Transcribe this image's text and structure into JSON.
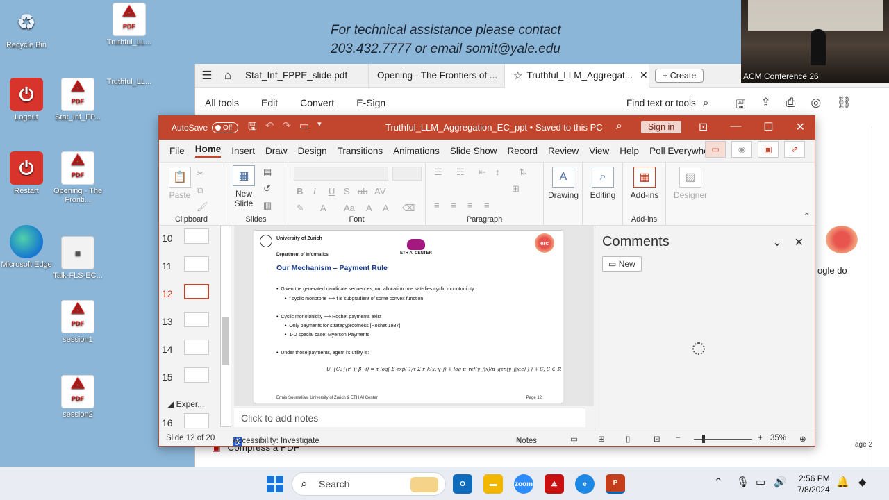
{
  "banner": {
    "line1": "For technical assistance please contact",
    "line2": "203.432.7777   or email somit@yale.edu"
  },
  "desktop_icons": [
    {
      "label": "Recycle Bin",
      "icon": "recycle-bin-icon"
    },
    {
      "label": "Truthful_LL...",
      "icon": "pdf-icon"
    },
    {
      "label": "Logout",
      "icon": "power-icon"
    },
    {
      "label": "Stat_Inf_FP...",
      "icon": "pdf-icon"
    },
    {
      "label": "Truthful_LL...",
      "icon": "powerpoint-icon"
    },
    {
      "label": "Restart",
      "icon": "power-icon"
    },
    {
      "label": "Opening - The Fronti...",
      "icon": "pdf-icon"
    },
    {
      "label": "Microsoft Edge",
      "icon": "edge-icon"
    },
    {
      "label": "Talk-FLS-EC...",
      "icon": "image-icon"
    },
    {
      "label": "session1",
      "icon": "pdf-icon"
    },
    {
      "label": "session2",
      "icon": "pdf-icon"
    }
  ],
  "webcam": {
    "label": "ACM Conference 26"
  },
  "acrobat": {
    "tabs": [
      "Stat_Inf_FPPE_slide.pdf",
      "Opening - The Frontiers of ...",
      "Truthful_LLM_Aggregat..."
    ],
    "create_label": "Create",
    "menu": [
      "All tools",
      "Edit",
      "Convert",
      "E-Sign"
    ],
    "find_label": "Find text or tools",
    "compress_label": "Compress a PDF",
    "peek_text": "ogle do",
    "page_label": "age 2"
  },
  "ppt": {
    "autosave_label": "AutoSave",
    "autosave_state": "Off",
    "title": "Truthful_LLM_Aggregation_EC_ppt  •  Saved to this PC",
    "signin_label": "Sign in",
    "ribbon_tabs": [
      "File",
      "Home",
      "Insert",
      "Draw",
      "Design",
      "Transitions",
      "Animations",
      "Slide Show",
      "Record",
      "Review",
      "View",
      "Help",
      "Poll Everywhere"
    ],
    "groups": {
      "clipboard": "Clipboard",
      "slides": "Slides",
      "font": "Font",
      "paragraph": "Paragraph",
      "addins": "Add-ins"
    },
    "buttons": {
      "paste": "Paste",
      "new_slide": "New Slide",
      "drawing": "Drawing",
      "editing": "Editing",
      "addins": "Add-ins",
      "designer": "Designer"
    },
    "thumbnails": [
      {
        "num": "10",
        "selected": false
      },
      {
        "num": "11",
        "selected": false
      },
      {
        "num": "12",
        "selected": true
      },
      {
        "num": "13",
        "selected": false
      },
      {
        "num": "14",
        "selected": false
      },
      {
        "num": "15",
        "selected": false
      },
      {
        "num": "16",
        "selected": false
      }
    ],
    "section_label": "Exper...",
    "slide": {
      "university": "University of Zurich",
      "department": "Department of Informatics",
      "eth": "ETH AI CENTER",
      "erc": "erc",
      "title": "Our Mechanism – Payment Rule",
      "bullets": [
        {
          "text": "Given the generated candidate sequences, our allocation rule satisfies cyclic monotonicity",
          "level": 1
        },
        {
          "text": "f cyclic monotone ⟺ f is subgradient of some convex function",
          "level": 2
        },
        {
          "text": "Cyclic monotonicity ⟹  Rochet payments exist",
          "level": 1
        },
        {
          "text": "Only payments for strategyproofness [Rochet 1987]",
          "level": 2
        },
        {
          "text": "1-D special case: Myerson Payments",
          "level": 2
        },
        {
          "text": "Under those payments, agent i's utility is:",
          "level": 1
        }
      ],
      "formula": "U_{C,i}(r'_i; β̂_-i) = τ log( Σ exp( 1/τ Σ r_k(x, y_j) + log π_ref(y_j|x)/π_gen(y_j|x;c̃) ) ) + C,  C ∈ ℝ",
      "footer": "Ermis Soumalias, University of Zurich & ETH AI Center",
      "page": "Page 12"
    },
    "notes_placeholder": "Click to add notes",
    "comments": {
      "title": "Comments",
      "new_label": "New"
    },
    "status": {
      "slide_info": "Slide 12 of 20",
      "accessibility": "Accessibility: Investigate",
      "notes": "Notes",
      "zoom": "35%"
    }
  },
  "taskbar": {
    "search_placeholder": "Search",
    "time": "2:56 PM",
    "date": "7/8/2024"
  }
}
